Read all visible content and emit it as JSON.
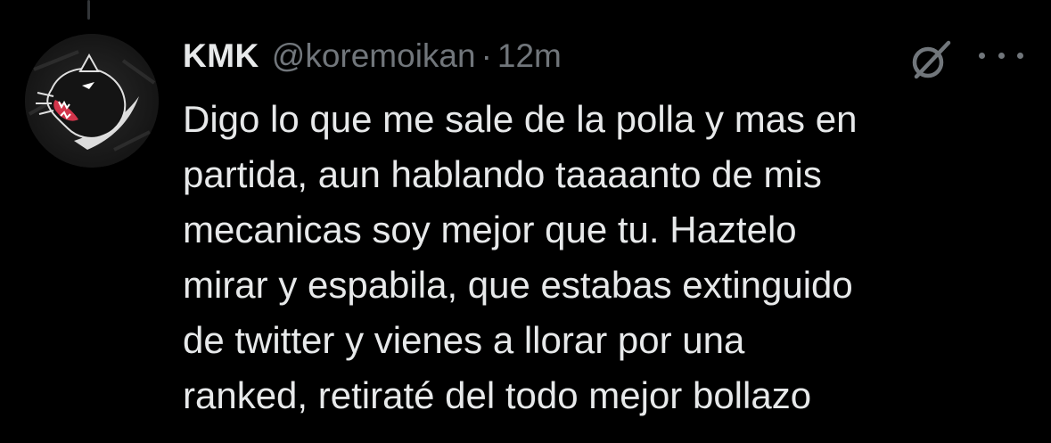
{
  "tweet": {
    "display_name": "KMK",
    "handle": "@koremoikan",
    "separator": "·",
    "time": "12m",
    "text_lines": [
      "Digo lo que me sale de la polla y mas en",
      "partida, aun hablando taaaanto de mis",
      "mecanicas soy mejor que tu. Haztelo",
      "mirar y espabila, que estabas extinguido",
      "de twitter y vienes a llorar por una",
      "ranked, retiraté del todo mejor bollazo"
    ]
  },
  "colors": {
    "background": "#000000",
    "primary_text": "#e7e9ea",
    "secondary_text": "#71767b",
    "thread_line": "#333639"
  },
  "icons": {
    "avatar": "black-panther-logo",
    "grok": "grok-icon",
    "more": "more-options-icon"
  }
}
